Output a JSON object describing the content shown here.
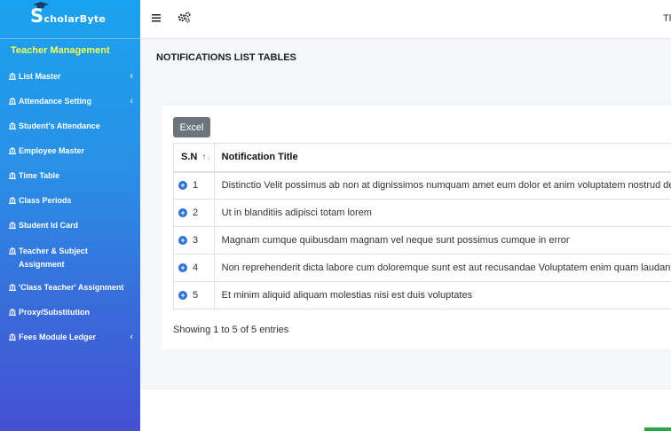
{
  "brand": {
    "name": "ScholarByte",
    "first_letter": "S",
    "rest": "cholarByte"
  },
  "sidebar": {
    "section_title": "Teacher Management",
    "items": [
      {
        "label": "List Master",
        "has_submenu": true
      },
      {
        "label": "Attendance Setting",
        "has_submenu": true
      },
      {
        "label": "Student's Attendance",
        "has_submenu": false
      },
      {
        "label": "Employee Master",
        "has_submenu": false
      },
      {
        "label": "Time Table",
        "has_submenu": false
      },
      {
        "label": "Class Periods",
        "has_submenu": false
      },
      {
        "label": "Student Id Card",
        "has_submenu": false
      },
      {
        "label": "Teacher & Subject Assignment",
        "has_submenu": false
      },
      {
        "label": "'Class Teacher' Assignment",
        "has_submenu": false
      },
      {
        "label": "Proxy/Substitution",
        "has_submenu": false
      },
      {
        "label": "Fees Module Ledger",
        "has_submenu": true
      }
    ],
    "chevron": "‹"
  },
  "topbar": {
    "menu_icon": "hamburger-icon",
    "settings_icon": "cogs-icon",
    "user_text": "Th"
  },
  "main": {
    "page_title": "NOTIFICATIONS LIST TABLES",
    "excel_label": "Excel",
    "columns": [
      "S.N",
      "Notification Title"
    ],
    "sort_icon": "↑↓",
    "rows": [
      {
        "sn": "1",
        "title": "Distinctio Velit possimus ab non at dignissimos numquam amet eum dolor et anim voluptatem nostrud del"
      },
      {
        "sn": "2",
        "title": "Ut in blanditiis adipisci totam lorem"
      },
      {
        "sn": "3",
        "title": "Magnam cumque quibusdam magnam vel neque sunt possimus cumque in error"
      },
      {
        "sn": "4",
        "title": "Non reprehenderit dicta labore cum doloremque sunt est aut recusandae Voluptatem enim quam laudanti"
      },
      {
        "sn": "5",
        "title": "Et minim aliquid aliquam molestias nisi est duis voluptates"
      }
    ],
    "info": "Showing 1 to 5 of 5 entries"
  },
  "colors": {
    "sidebar_top": "#1aa3ee",
    "sidebar_bottom": "#4450d2",
    "section_title": "#f4ff5a",
    "excel_button": "#6c757d",
    "expand_dot": "#2e6fd8"
  }
}
